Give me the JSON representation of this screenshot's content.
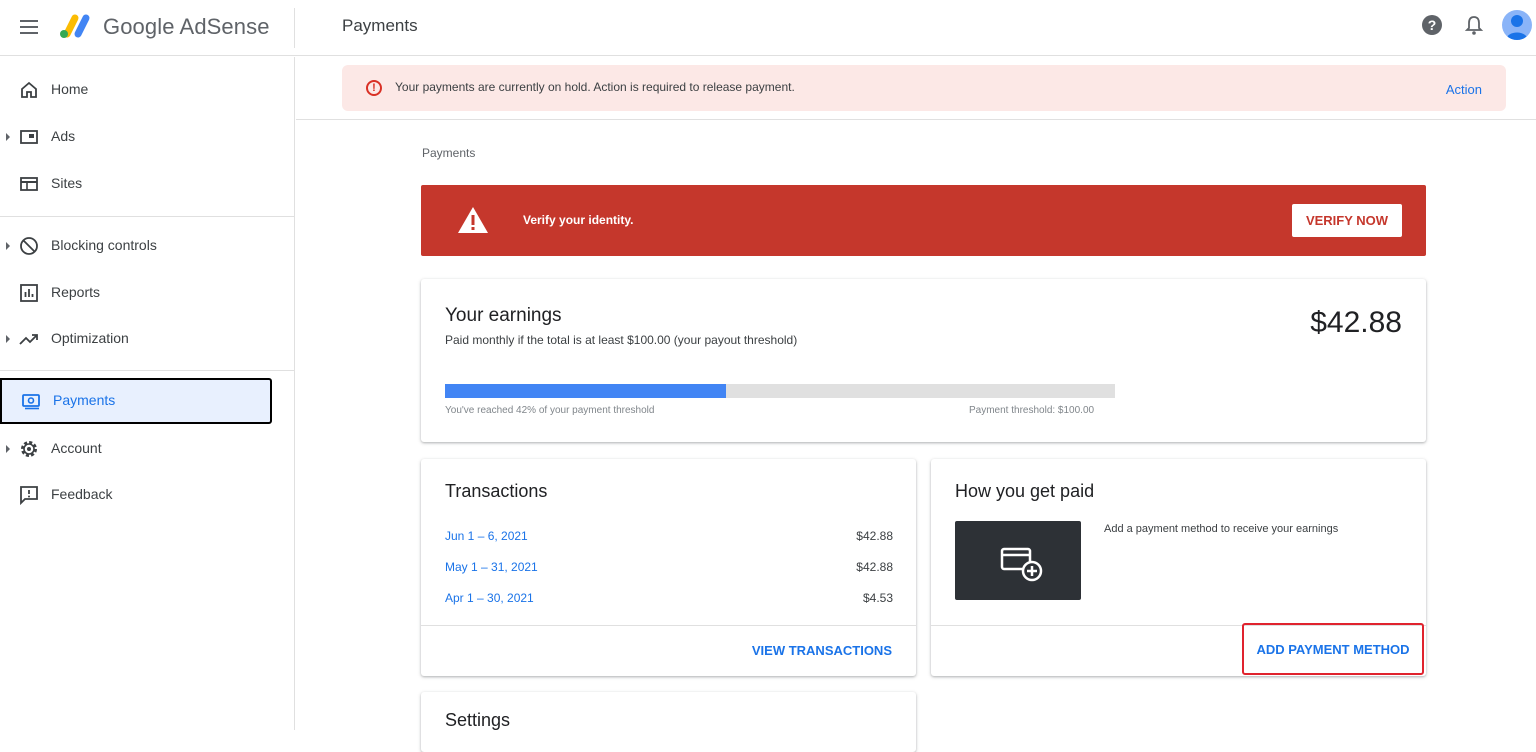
{
  "header": {
    "brand": "Google AdSense",
    "title": "Payments"
  },
  "sidebar": {
    "items": [
      {
        "label": "Home"
      },
      {
        "label": "Ads"
      },
      {
        "label": "Sites"
      },
      {
        "label": "Blocking controls"
      },
      {
        "label": "Reports"
      },
      {
        "label": "Optimization"
      },
      {
        "label": "Payments"
      },
      {
        "label": "Account"
      },
      {
        "label": "Feedback"
      }
    ]
  },
  "hold_banner": {
    "icon": "!",
    "message": "Your payments are currently on hold. Action is required to release payment.",
    "action": "Action"
  },
  "breadcrumb": "Payments",
  "verify": {
    "message": "Verify your identity.",
    "button": "VERIFY NOW",
    "color": "#c5372c"
  },
  "earnings": {
    "title": "Your earnings",
    "subtitle": "Paid monthly if the total is at least $100.00 (your payout threshold)",
    "amount": "$42.88",
    "progress_fraction": 0.42,
    "progress_label": "You've reached 42% of your payment threshold",
    "threshold_label": "Payment threshold: $100.00"
  },
  "transactions": {
    "title": "Transactions",
    "rows": [
      {
        "period": "Jun 1 – 6, 2021",
        "amount": "$42.88"
      },
      {
        "period": "May 1 – 31, 2021",
        "amount": "$42.88"
      },
      {
        "period": "Apr 1 – 30, 2021",
        "amount": "$4.53"
      }
    ],
    "action": "VIEW TRANSACTIONS"
  },
  "how_paid": {
    "title": "How you get paid",
    "description": "Add a payment method to receive your earnings",
    "action": "ADD PAYMENT METHOD"
  },
  "settings": {
    "title": "Settings"
  },
  "colors": {
    "accent": "#1a73e8",
    "alert_bg": "#fce8e6",
    "progress": "#4285f4"
  }
}
